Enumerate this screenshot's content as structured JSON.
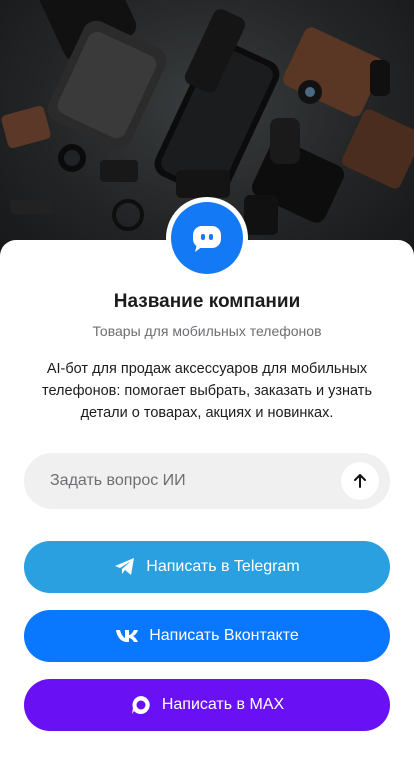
{
  "company": {
    "name": "Название компании",
    "tagline": "Товары для мобильных телефонов",
    "description": "AI-бот для продаж аксессуаров для мобильных телефонов: помогает выбрать, заказать и узнать детали о товарах, акциях и новинках."
  },
  "ask": {
    "placeholder": "Задать вопрос ИИ",
    "send_icon": "arrow-up-icon"
  },
  "buttons": {
    "telegram": {
      "label": "Написать в Telegram",
      "icon": "telegram-icon",
      "color": "#2aa0e0"
    },
    "vk": {
      "label": "Написать Вконтакте",
      "icon": "vk-icon",
      "color": "#0a77ff"
    },
    "max": {
      "label": "Написать в MAX",
      "icon": "max-icon",
      "color": "#6a10f5"
    }
  },
  "colors": {
    "avatar": "#1479f5"
  }
}
